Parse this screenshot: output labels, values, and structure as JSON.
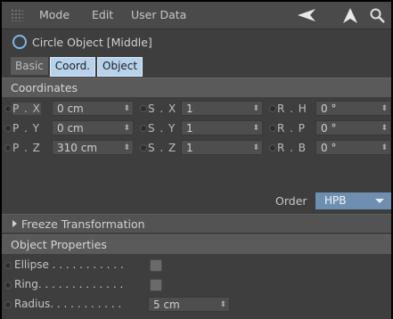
{
  "menubar": {
    "items": [
      "Mode",
      "Edit",
      "User Data"
    ],
    "icons": [
      "back-arrow-icon",
      "cursor-up-icon",
      "search-icon"
    ]
  },
  "object": {
    "title": "Circle Object [Middle]",
    "icon": "circle-object-icon"
  },
  "tabs": [
    {
      "label": "Basic",
      "active": false
    },
    {
      "label": "Coord.",
      "active": true
    },
    {
      "label": "Object",
      "active": true
    }
  ],
  "coordinates": {
    "header": "Coordinates",
    "rows": [
      {
        "p_label": "P . X",
        "p_value": "0 cm",
        "s_label": "S . X",
        "s_value": "1",
        "r_label": "R . H",
        "r_value": "0 °"
      },
      {
        "p_label": "P . Y",
        "p_value": "0 cm",
        "s_label": "S . Y",
        "s_value": "1",
        "r_label": "R . P",
        "r_value": "0 °"
      },
      {
        "p_label": "P . Z",
        "p_value": "310 cm",
        "s_label": "S . Z",
        "s_value": "1",
        "r_label": "R . B",
        "r_value": "0 °"
      }
    ],
    "order_label": "Order",
    "order_value": "HPB",
    "freeze": "Freeze Transformation"
  },
  "object_properties": {
    "header": "Object Properties",
    "ellipse_label": "Ellipse . . . . . . . . . . .",
    "ring_label": "Ring. . . . . . . . . . . . .",
    "radius_label": "Radius. . . . . . . . . . .",
    "radius_value": "5 cm"
  },
  "colors": {
    "panel": "#3e3e3e",
    "accent_tab": "#b7d3ec",
    "order_select": "#6e8fb0",
    "circle_icon": "#7fb6e8"
  }
}
